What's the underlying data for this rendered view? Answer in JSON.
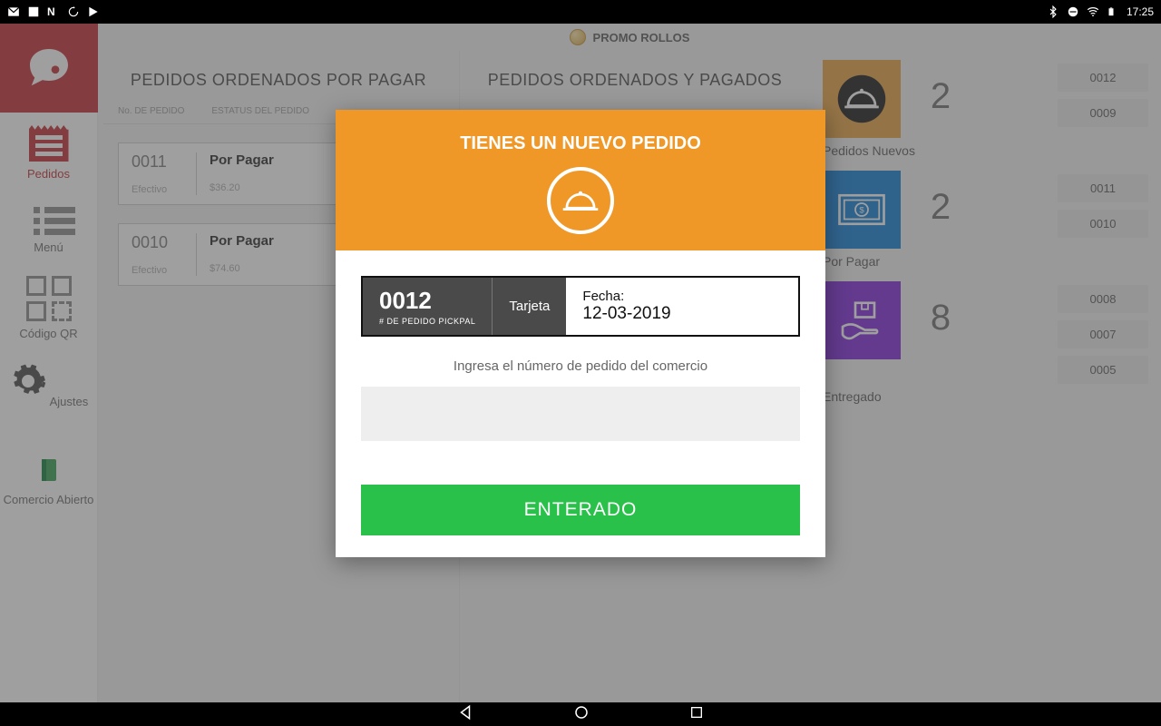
{
  "statusbar": {
    "time": "17:25"
  },
  "header": {
    "title": "PROMO ROLLOS"
  },
  "sidebar": {
    "items": [
      {
        "label": "Pedidos"
      },
      {
        "label": "Menú"
      },
      {
        "label": "Código QR"
      },
      {
        "label": "Ajustes"
      },
      {
        "label": "Comercio Abierto"
      }
    ]
  },
  "sections": {
    "to_pay": {
      "title": "PEDIDOS ORDENADOS POR PAGAR",
      "col_order": "No. DE PEDIDO",
      "col_status": "ESTATUS DEL PEDIDO",
      "orders": [
        {
          "num": "0011",
          "pay_method": "Efectivo",
          "status": "Por Pagar",
          "amount": "$36.20"
        },
        {
          "num": "0010",
          "pay_method": "Efectivo",
          "status": "Por Pagar",
          "amount": "$74.60"
        }
      ]
    },
    "paid": {
      "title": "PEDIDOS ORDENADOS Y PAGADOS"
    }
  },
  "rail": {
    "new": {
      "label": "Pedidos Nuevos",
      "count": "2",
      "ids": [
        "0012",
        "0009"
      ]
    },
    "to_pay": {
      "label": "Por Pagar",
      "count": "2",
      "ids": [
        "0011",
        "0010"
      ]
    },
    "delivered": {
      "label": "Entregado",
      "count": "8",
      "ids": [
        "0008",
        "0007",
        "0005"
      ]
    }
  },
  "modal": {
    "title": "TIENES UN NUEVO PEDIDO",
    "order_num": "0012",
    "order_num_label": "# DE PEDIDO PICKPAL",
    "pay_method": "Tarjeta",
    "date_label": "Fecha:",
    "date_value": "12-03-2019",
    "input_hint": "Ingresa el número de pedido del comercio",
    "input_value": "",
    "confirm_label": "ENTERADO"
  }
}
